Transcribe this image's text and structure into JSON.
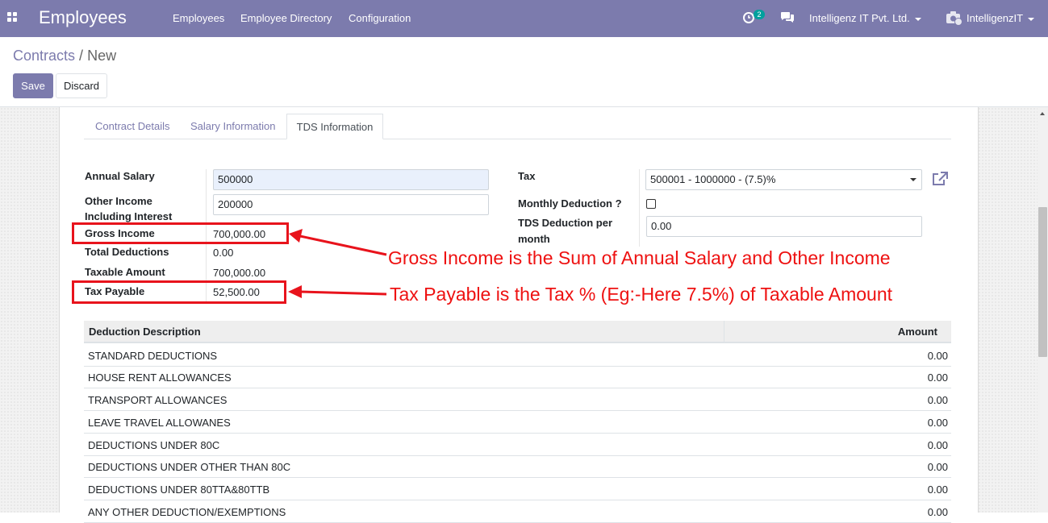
{
  "navbar": {
    "brand": "Employees",
    "menu": [
      "Employees",
      "Employee Directory",
      "Configuration"
    ],
    "activity_count": "2",
    "company": "Intelligenz IT Pvt. Ltd.",
    "user": "IntelligenzIT",
    "color": "#7c7bad"
  },
  "breadcrumb": {
    "parent": "Contracts",
    "separator": "/",
    "current": "New"
  },
  "buttons": {
    "save": "Save",
    "discard": "Discard"
  },
  "tabs": {
    "contract_details": "Contract Details",
    "salary_information": "Salary Information",
    "tds_information": "TDS Information",
    "active": "TDS Information"
  },
  "form": {
    "annual_salary": {
      "label": "Annual Salary",
      "value": "500000"
    },
    "other_income": {
      "label_line1": "Other Income",
      "label_line2": "Including Interest",
      "value": "200000"
    },
    "gross_income": {
      "label": "Gross Income",
      "value": "700,000.00"
    },
    "total_deductions": {
      "label": "Total Deductions",
      "value": "0.00"
    },
    "taxable_amount": {
      "label": "Taxable Amount",
      "value": "700,000.00"
    },
    "tax_payable": {
      "label": "Tax Payable",
      "value": "52,500.00"
    },
    "tax": {
      "label": "Tax",
      "value": "500001 - 1000000 - (7.5)%"
    },
    "monthly_deduction": {
      "label": "Monthly Deduction ?",
      "checked": false
    },
    "tds_deduction": {
      "label_line1": "TDS Deduction per",
      "label_line2": "month",
      "value": "0.00"
    }
  },
  "annotations": {
    "gross": "Gross Income is the Sum of Annual Salary and Other Income",
    "tax": "Tax Payable is the Tax % (Eg:-Here 7.5%) of Taxable Amount",
    "color": "#e8131c"
  },
  "table": {
    "headers": {
      "description": "Deduction Description",
      "amount": "Amount"
    },
    "rows": [
      {
        "description": "STANDARD DEDUCTIONS",
        "amount": "0.00"
      },
      {
        "description": "HOUSE RENT ALLOWANCES",
        "amount": "0.00"
      },
      {
        "description": "TRANSPORT ALLOWANCES",
        "amount": "0.00"
      },
      {
        "description": "LEAVE TRAVEL ALLOWANES",
        "amount": "0.00"
      },
      {
        "description": "DEDUCTIONS UNDER 80C",
        "amount": "0.00"
      },
      {
        "description": "DEDUCTIONS UNDER OTHER THAN 80C",
        "amount": "0.00"
      },
      {
        "description": "DEDUCTIONS UNDER 80TTA&80TTB",
        "amount": "0.00"
      },
      {
        "description": "ANY OTHER DEDUCTION/EXEMPTIONS",
        "amount": "0.00"
      }
    ]
  }
}
